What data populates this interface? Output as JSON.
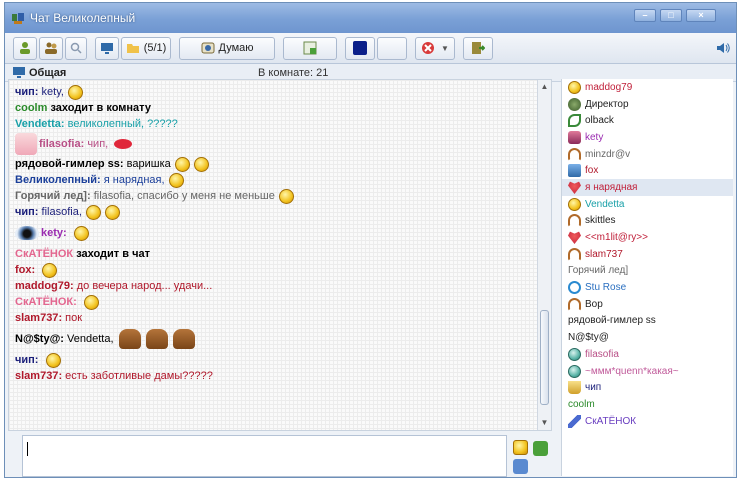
{
  "window": {
    "title": "Чат Великолепный"
  },
  "toolbar": {
    "count_label": "(5/1)",
    "status_label": "Думаю"
  },
  "room": {
    "name": "Общая",
    "count": "В комнате: 21"
  },
  "messages": [
    {
      "nick": "чип",
      "sep": ": ",
      "text": "kety,",
      "nick_color": "#1b1f7a",
      "text_color": "#1b1f7a",
      "kind": "normal"
    },
    {
      "nick": "coolm",
      "sep": " ",
      "text": "заходит в комнату",
      "nick_color": "#2a8a2a",
      "text_color": "#000000",
      "kind": "system"
    },
    {
      "nick": "Vendetta",
      "sep": ": ",
      "text": "великолепный, ?????",
      "nick_color": "#18a0a8",
      "text_color": "#18a0a8",
      "kind": "normal"
    },
    {
      "nick": "filasofia",
      "sep": ": ",
      "text": "чип,",
      "nick_color": "#b84f86",
      "text_color": "#b84f86",
      "kind": "avatar"
    },
    {
      "nick": "рядовой-гимлер ss",
      "sep": ": ",
      "text": "варишка",
      "nick_color": "#000000",
      "text_color": "#000000",
      "kind": "normal"
    },
    {
      "nick": "Великолепный",
      "sep": ": ",
      "text": "я нарядная,",
      "nick_color": "#1b3f9a",
      "text_color": "#1b3f9a",
      "kind": "normal"
    },
    {
      "nick": "Горячий лед]",
      "sep": ": ",
      "text": "filasofia, спасибо у меня не меньше",
      "nick_color": "#666666",
      "text_color": "#666666",
      "kind": "normal"
    },
    {
      "nick": "чип",
      "sep": ": ",
      "text": "filasofia,",
      "nick_color": "#1b1f7a",
      "text_color": "#1b1f7a",
      "kind": "normal"
    },
    {
      "nick": "kety",
      "sep": ": ",
      "text": "",
      "nick_color": "#9a2bb0",
      "text_color": "#9a2bb0",
      "kind": "eye"
    },
    {
      "nick": "СкАТЁНОК",
      "sep": " ",
      "text": "заходит в чат",
      "nick_color": "#e3668f",
      "text_color": "#000000",
      "kind": "system"
    },
    {
      "nick": "fox",
      "sep": ": ",
      "text": "",
      "nick_color": "#b0182b",
      "text_color": "#b0182b",
      "kind": "normal"
    },
    {
      "nick": "maddog79",
      "sep": ": ",
      "text": "до вечера народ... удачи...",
      "nick_color": "#b0182b",
      "text_color": "#b0182b",
      "kind": "normal"
    },
    {
      "nick": "СкАТЁНОК",
      "sep": ": ",
      "text": "",
      "nick_color": "#e3668f",
      "text_color": "#e3668f",
      "kind": "normal"
    },
    {
      "nick": "slam737",
      "sep": ": ",
      "text": "пок",
      "nick_color": "#b0182b",
      "text_color": "#b0182b",
      "kind": "normal"
    },
    {
      "nick": "N@$ty@",
      "sep": ": ",
      "text": "Vendetta,",
      "nick_color": "#000000",
      "text_color": "#000000",
      "kind": "beavers"
    },
    {
      "nick": "чип",
      "sep": ": ",
      "text": "",
      "nick_color": "#1b1f7a",
      "text_color": "#1b1f7a",
      "kind": "normal"
    },
    {
      "nick": "slam737",
      "sep": ": ",
      "text": "есть заботливые дамы?????",
      "nick_color": "#b0182b",
      "text_color": "#b0182b",
      "kind": "normal"
    }
  ],
  "users": [
    {
      "name": "maddog79",
      "color": "#c0203a",
      "icon": "smiley-icon"
    },
    {
      "name": "Директор",
      "color": "#222222",
      "icon": "director-icon"
    },
    {
      "name": "olback",
      "color": "#222222",
      "icon": "leaf-icon"
    },
    {
      "name": "kety",
      "color": "#9a2bb0",
      "icon": "kitty-icon"
    },
    {
      "name": "minzdr@v",
      "color": "#666666",
      "icon": "headphones-icon"
    },
    {
      "name": "fox",
      "color": "#b0182b",
      "icon": "box-icon"
    },
    {
      "name": "я нарядная",
      "color": "#c0203a",
      "icon": "heart-icon"
    },
    {
      "name": "Vendetta",
      "color": "#18a0a8",
      "icon": "smiley-icon"
    },
    {
      "name": "skittles",
      "color": "#222222",
      "icon": "headphones-icon"
    },
    {
      "name": "<<m1lit@ry>>",
      "color": "#c0203a",
      "icon": "heart-icon"
    },
    {
      "name": "slam737",
      "color": "#b0182b",
      "icon": "headphones-icon"
    },
    {
      "name": "Горячий лед]",
      "color": "#666666",
      "icon": "none"
    },
    {
      "name": "Stu Rose",
      "color": "#2a6fc0",
      "icon": "at-icon"
    },
    {
      "name": "Bop",
      "color": "#222222",
      "icon": "headphones-icon"
    },
    {
      "name": "рядовой-гимлер ss",
      "color": "#222222",
      "icon": "none"
    },
    {
      "name": "N@$ty@",
      "color": "#222222",
      "icon": "none"
    },
    {
      "name": "filasofia",
      "color": "#b84f86",
      "icon": "smiley-blue-icon"
    },
    {
      "name": "~ммм*quenn*какая~",
      "color": "#c05a9a",
      "icon": "smiley-blue-icon"
    },
    {
      "name": "чип",
      "color": "#1b1f7a",
      "icon": "cup-icon"
    },
    {
      "name": "coolm",
      "color": "#2a8a2a",
      "icon": "none"
    },
    {
      "name": "СкАТЁНОК",
      "color": "#6a3fc0",
      "icon": "pen-icon"
    }
  ],
  "selected_user": "я нарядная"
}
